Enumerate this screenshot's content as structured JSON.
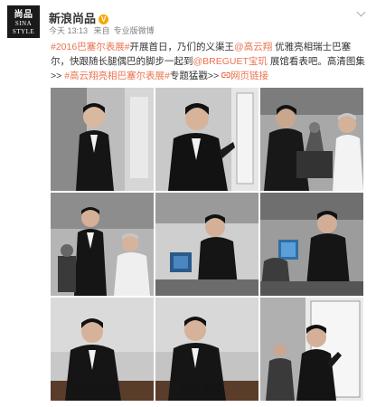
{
  "header": {
    "avatar_line1": "尚品",
    "avatar_line2": "SINA",
    "avatar_line3": "STYLE",
    "username": "新浪尚品",
    "verified_mark": "V",
    "time": "今天 13:13",
    "source_prefix": "来自",
    "source": "专业版微博"
  },
  "post": {
    "hashtag1": "#2016巴塞尔表展#",
    "text1": "开展首日，乃们的义渠王",
    "mention1": "@高云翔",
    "text2": " 优雅亮相瑞士巴塞尔，快跟随长腿偶巴的脚步一起到",
    "mention2": "@BREGUET宝玑",
    "text3": " 展馆看表吧。高清图集>> ",
    "hashtag2": "#高云翔亮相巴塞尔表展#",
    "topic_link": "专题猛戳>>",
    "webpage_link": "网页链接",
    "webpage_icon": "link-icon"
  },
  "photos": [
    {
      "name": "photo-1"
    },
    {
      "name": "photo-2"
    },
    {
      "name": "photo-3"
    },
    {
      "name": "photo-4"
    },
    {
      "name": "photo-5"
    },
    {
      "name": "photo-6"
    },
    {
      "name": "photo-7"
    },
    {
      "name": "photo-8"
    },
    {
      "name": "photo-9"
    }
  ],
  "colors": {
    "link": "#eb7350",
    "text": "#333333",
    "meta": "#808080"
  }
}
